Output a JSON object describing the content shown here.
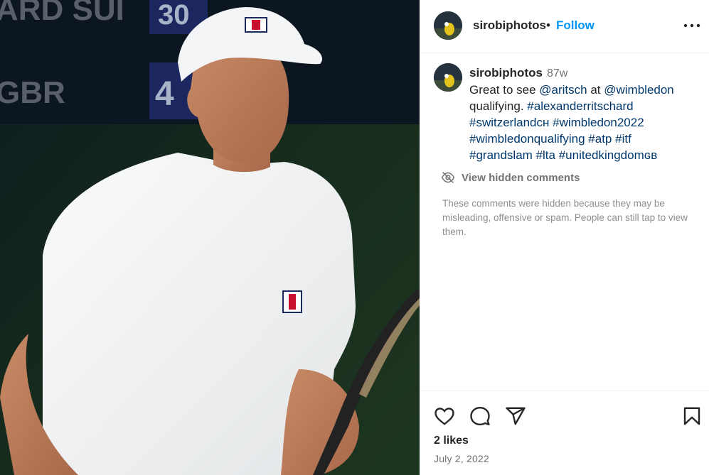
{
  "header": {
    "username": "sirobiphotos",
    "separator": "•",
    "follow_label": "Follow",
    "more_icon": "more-options-icon"
  },
  "caption": {
    "username": "sirobiphotos",
    "time": "87w",
    "text_plain_1": "Great to see ",
    "mention_1": "@aritsch",
    "text_plain_2": " at ",
    "mention_2": "@wimbledon",
    "text_plain_3": " qualifying. ",
    "tag_1": "#alexanderritschard",
    "tag_2": "#switzerlandᴄʜ",
    "tag_3": "#wimbledon2022",
    "tag_4": "#wimbledonqualifying",
    "tag_5": "#atp",
    "tag_6": "#itf",
    "tag_7": "#grandslam",
    "tag_8": "#lta",
    "tag_9": "#unitedkingdomɢʙ"
  },
  "hidden_comments": {
    "label": "View hidden comments",
    "note": "These comments were hidden because they may be misleading, offensive or spam. People can still tap to view them."
  },
  "actions": {
    "likes": "2 likes",
    "date": "July 2, 2022"
  },
  "photo": {
    "scoreboard_1": "ARD SUI",
    "scoreboard_2": "GBR",
    "score_1": "30",
    "score_2": "4"
  },
  "colors": {
    "follow": "#0095f6",
    "link": "#00376b",
    "muted": "#737373"
  }
}
